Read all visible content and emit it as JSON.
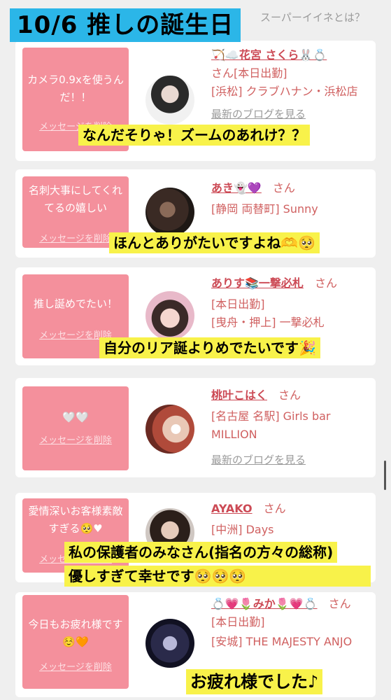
{
  "header": {
    "title": "10/6 推しの誕生日",
    "link": "スーパーイイネとは？"
  },
  "colors": {
    "title_bg": "#2bb6e8",
    "message_box": "#f4909c",
    "cast_name": "#cc4a55",
    "caption_bg": "#f8f24a"
  },
  "cards": [
    {
      "message": "カメラ0.9xを使うんだ！！",
      "delete_label": "メッセージを削除",
      "name": "🏹☁️花宮 さくら🐰💍",
      "san": "さん",
      "line1": "[本日出勤]",
      "line2": "[浜松] クラブハナン・浜松店",
      "blog": "最新のブログを見る",
      "caption": "なんだそりゃ！ズームのあれけ？？"
    },
    {
      "message": "名刺大事にしてくれてるの嬉しい",
      "delete_label": "メッセージを削除",
      "name": "あき👻💜",
      "san": "さん",
      "line1": "[静岡 両替町] Sunny",
      "caption": "ほんとありがたいですよね🫶🥺"
    },
    {
      "message": "推し誕めでたい！",
      "delete_label": "メッセージを削除",
      "name": "ありす📚一撃必札",
      "san": "さん",
      "line1": "[本日出勤]",
      "line2": "[曳舟・押上] 一撃必札",
      "caption": "自分のリア誕よりめでたいです🎉"
    },
    {
      "message": "🤍🤍",
      "delete_label": "メッセージを削除",
      "name": "桃叶こはく",
      "san": "さん",
      "line1": "[名古屋 名駅] Girls bar MILLION",
      "blog": "最新のブログを見る"
    },
    {
      "message": "愛情深いお客様素敵すぎる🥺♥",
      "delete_label": "メッセージを削除",
      "name": "AYAKO",
      "san": "さん",
      "line1": "[中洲] Days",
      "caption_line1": "私の保護者のみなさん(指名の方々の総称)",
      "caption_line2": "優しすぎて幸せです🥺🥺🥺"
    },
    {
      "message": "今日もお疲れ様です☺️🧡",
      "delete_label": "メッセージを削除",
      "name": "💍💗🌷みか🌷💗💍",
      "san": "さん",
      "line1": "[本日出勤]",
      "line2": "[安城] THE MAJESTY ANJO",
      "caption": "お疲れ様でした♪"
    }
  ]
}
